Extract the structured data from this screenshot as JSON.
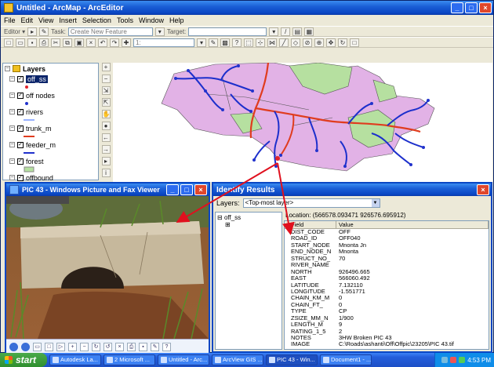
{
  "arcmap": {
    "title": "Untitled - ArcMap - ArcEditor",
    "menu": [
      "File",
      "Edit",
      "View",
      "Insert",
      "Selection",
      "Tools",
      "Window",
      "Help"
    ],
    "editor_label": "Editor ▾",
    "task_label": "Task:",
    "task_value": "Create New Feature",
    "target_label": "Target:",
    "scale_value": "1:"
  },
  "toc": {
    "root": "Layers",
    "layers": [
      {
        "name": "off_ss",
        "color": "#e0242c",
        "selected": true
      },
      {
        "name": "off nodes",
        "color": "#2233cc"
      },
      {
        "name": "rivers",
        "color": "#3366ff"
      },
      {
        "name": "trunk_m",
        "color": "#e03c1e"
      },
      {
        "name": "feeder_m",
        "color": "#2030cc"
      },
      {
        "name": "forest",
        "color": "#b6e0a0"
      },
      {
        "name": "offbound",
        "color": "#e3b3e3"
      }
    ]
  },
  "viewer": {
    "title": "PIC 43 - Windows Picture and Fax Viewer"
  },
  "identify": {
    "title": "Identify Results",
    "layers_label": "Layers:",
    "layers_value": "<Top-most layer>",
    "tree_root": "off_ss",
    "location": "Location: (566578.093471 926576.695912)",
    "col_field": "Field",
    "col_value": "Value",
    "rows": [
      {
        "f": "DIST_CODE",
        "v": "OFF"
      },
      {
        "f": "ROAD_ID",
        "v": "OFF040"
      },
      {
        "f": "START_NODE",
        "v": "Mnonta Jn"
      },
      {
        "f": "END_NODE_N",
        "v": "Mnonta"
      },
      {
        "f": "STRUCT_NO_",
        "v": "70"
      },
      {
        "f": "RIVER_NAME",
        "v": ""
      },
      {
        "f": "NORTH",
        "v": "926496.665"
      },
      {
        "f": "EAST",
        "v": "566060.492"
      },
      {
        "f": "LATITUDE",
        "v": "7.132110"
      },
      {
        "f": "LONGITUDE",
        "v": "-1.551771"
      },
      {
        "f": "CHAIN_KM_M",
        "v": "0"
      },
      {
        "f": "CHAIN_FT_",
        "v": "0"
      },
      {
        "f": "TYPE",
        "v": "CP"
      },
      {
        "f": "ZSIZE_MM_N",
        "v": "1/900"
      },
      {
        "f": "LENGTH_M",
        "v": "9"
      },
      {
        "f": "RATING_1_5",
        "v": "2"
      },
      {
        "f": "NOTES",
        "v": "3HW Broken PIC 43"
      },
      {
        "f": "IMAGE",
        "v": "C:\\Roads\\ashanti\\Off\\Offpic\\23205\\PIC 43.tif"
      }
    ]
  },
  "taskbar": {
    "start": "start",
    "tasks": [
      "Autodesk La...",
      "2 Microsoft ...",
      "Untitled - Arc...",
      "ArcView GIS ...",
      "PIC 43 - Win...",
      "Document1 - ..."
    ],
    "clock": "4:53 PM"
  }
}
